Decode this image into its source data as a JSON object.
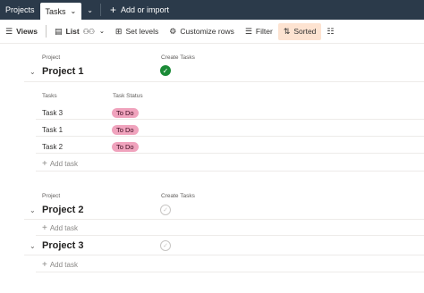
{
  "tabs": {
    "projects_label": "Projects",
    "tasks_label": "Tasks",
    "add_import_label": "Add or import"
  },
  "toolbar": {
    "views_label": "Views",
    "list_label": "List",
    "set_levels_label": "Set levels",
    "customize_rows_label": "Customize rows",
    "filter_label": "Filter",
    "sorted_label": "Sorted"
  },
  "columns": {
    "project": "Project",
    "create_tasks": "Create Tasks",
    "tasks": "Tasks",
    "task_status": "Task Status"
  },
  "groups": [
    {
      "title": "Project 1",
      "create_tasks_done": true,
      "tasks": [
        {
          "name": "Task 3",
          "status": "To Do"
        },
        {
          "name": "Task 1",
          "status": "To Do"
        },
        {
          "name": "Task 2",
          "status": "To Do"
        }
      ],
      "add_task_label": "Add task"
    },
    {
      "title": "Project 2",
      "create_tasks_done": false,
      "add_task_label": "Add task"
    },
    {
      "title": "Project 3",
      "create_tasks_done": false,
      "add_task_label": "Add task"
    }
  ],
  "colors": {
    "topbar": "#2b3a4a",
    "done_check": "#1a8a36",
    "todo_badge": "#f0a3bd",
    "sorted_highlight": "#fde3d1"
  }
}
